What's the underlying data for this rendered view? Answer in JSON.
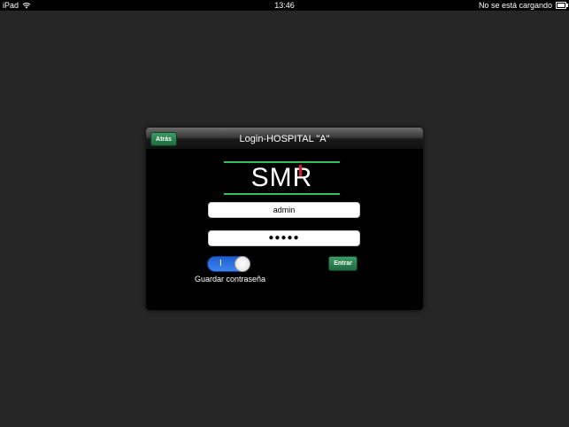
{
  "statusbar": {
    "device": "iPad",
    "time": "13:46",
    "charging_status": "No se está cargando"
  },
  "modal": {
    "title": "Login-HOSPITAL \"A\"",
    "back_label": "Atrás",
    "logo_text": "SMR",
    "username_value": "admin",
    "password_value": "●●●●●",
    "toggle_on_label": "I",
    "toggle_state": "on",
    "save_password_label": "Guardar contraseña",
    "enter_label": "Entrar"
  },
  "colors": {
    "background": "#262626",
    "button_green": "#2a7d4f",
    "toggle_blue": "#2f74e6",
    "logo_green": "#2fbf56",
    "logo_red": "#d81e2a"
  }
}
